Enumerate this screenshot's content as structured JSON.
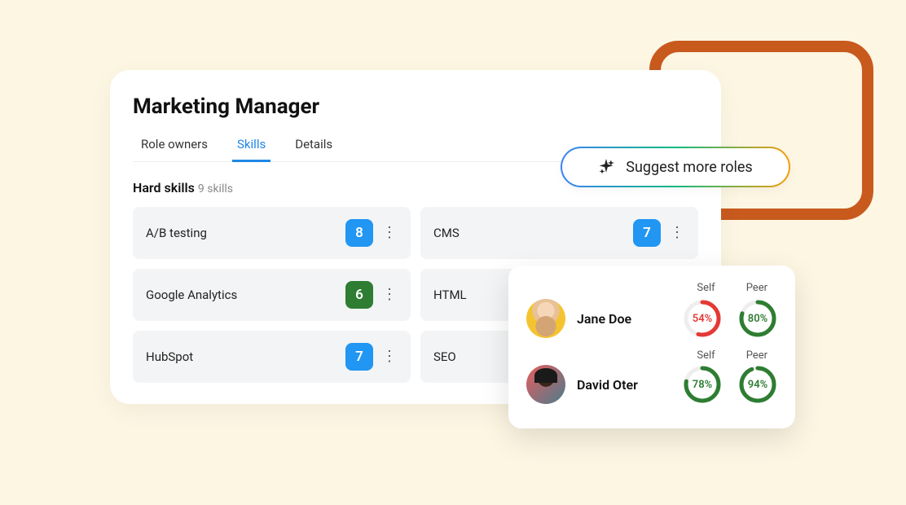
{
  "title": "Marketing Manager",
  "tabs": [
    {
      "label": "Role owners",
      "active": false
    },
    {
      "label": "Skills",
      "active": true
    },
    {
      "label": "Details",
      "active": false
    }
  ],
  "section": {
    "label": "Hard skills",
    "count": "9 skills"
  },
  "skills": [
    {
      "name": "A/B testing",
      "score": "8",
      "color": "blue",
      "menu": true
    },
    {
      "name": "CMS",
      "score": "7",
      "color": "blue",
      "menu": true
    },
    {
      "name": "Google Analytics",
      "score": "6",
      "color": "green",
      "menu": true
    },
    {
      "name": "HTML",
      "score": "",
      "color": "",
      "menu": false
    },
    {
      "name": "HubSpot",
      "score": "7",
      "color": "blue",
      "menu": true
    },
    {
      "name": "SEO",
      "score": "",
      "color": "",
      "menu": false
    }
  ],
  "suggest": {
    "label": "Suggest more roles"
  },
  "headers": {
    "self": "Self",
    "peer": "Peer"
  },
  "people": [
    {
      "name": "Jane Doe",
      "avatar": "jane",
      "self": {
        "pct": 54,
        "label": "54%",
        "color": "red"
      },
      "peer": {
        "pct": 80,
        "label": "80%",
        "color": "green"
      }
    },
    {
      "name": "David Oter",
      "avatar": "david",
      "self": {
        "pct": 78,
        "label": "78%",
        "color": "green"
      },
      "peer": {
        "pct": 94,
        "label": "94%",
        "color": "green"
      }
    }
  ]
}
